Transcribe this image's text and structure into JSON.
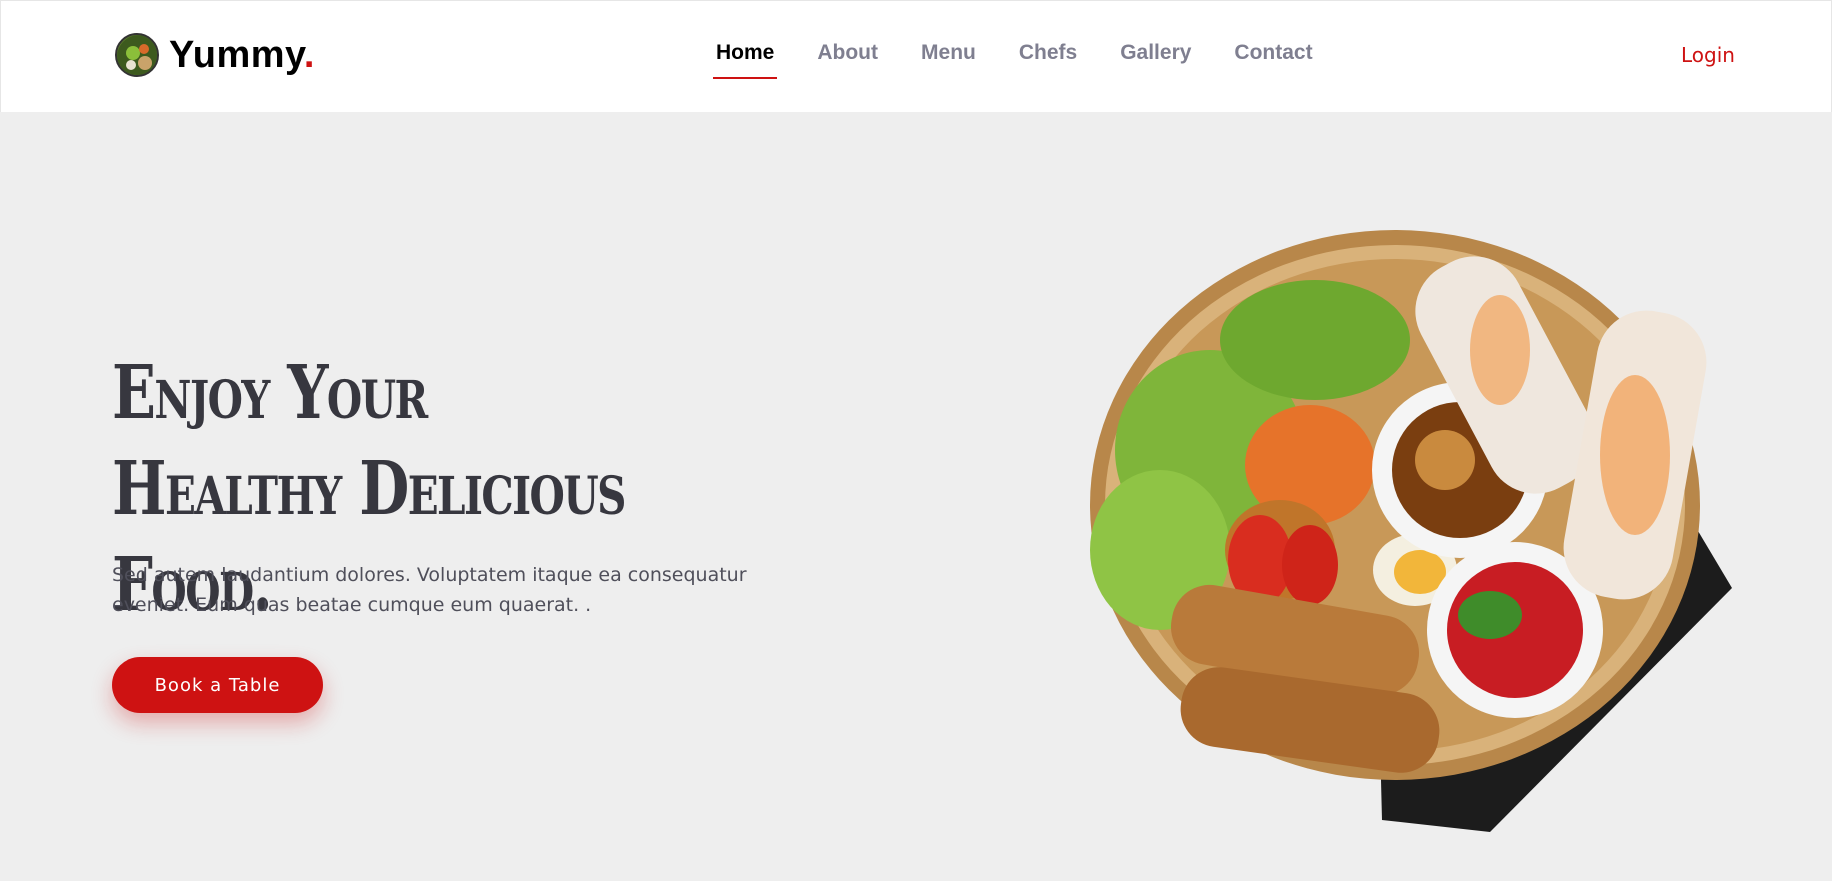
{
  "header": {
    "logo_text": "Yummy",
    "logo_dot": ".",
    "nav": [
      {
        "label": "Home",
        "active": true
      },
      {
        "label": "About",
        "active": false
      },
      {
        "label": "Menu",
        "active": false
      },
      {
        "label": "Chefs",
        "active": false
      },
      {
        "label": "Gallery",
        "active": false
      },
      {
        "label": "Contact",
        "active": false
      }
    ],
    "login_label": "Login"
  },
  "hero": {
    "title": "Enjoy Your Healthy Delicious Food.",
    "text": "Sed autem laudantium dolores. Voluptatem itaque ea consequatur eveniet. Eum quas beatae cumque eum quaerat. .",
    "button_label": "Book a Table"
  },
  "colors": {
    "accent": "#ce1212",
    "background": "#eeeeee",
    "header_bg": "#ffffff",
    "nav_text": "#7f7f90"
  }
}
